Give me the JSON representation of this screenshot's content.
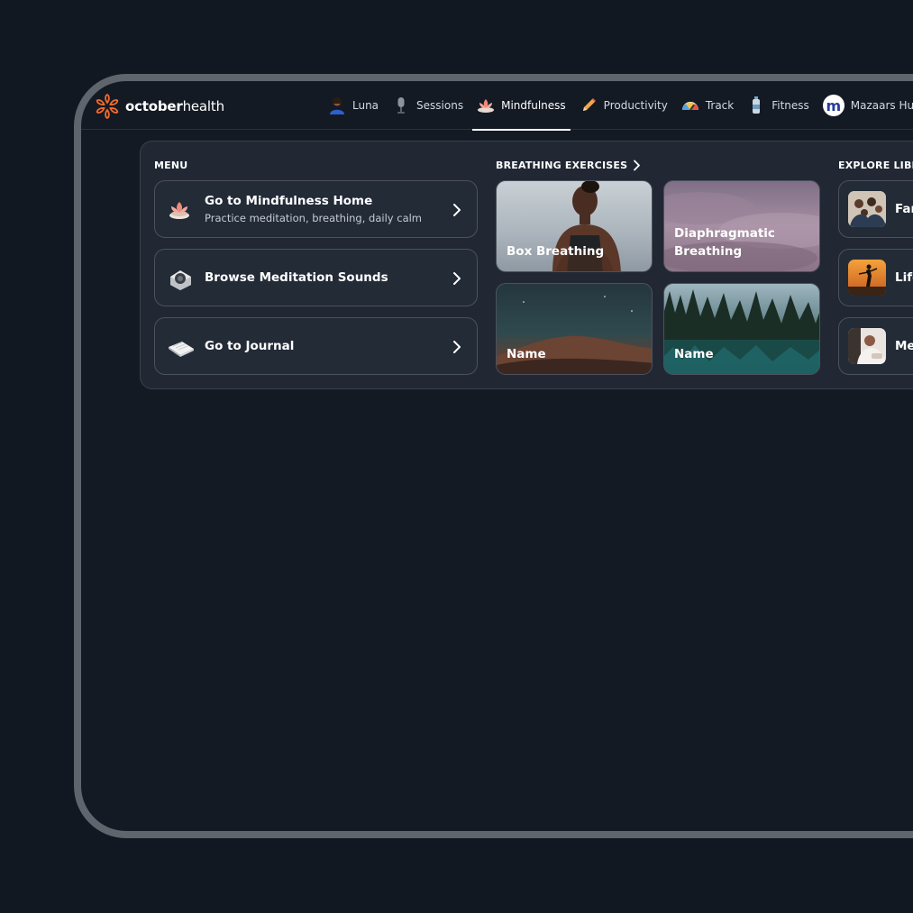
{
  "brand": {
    "name_bold": "october",
    "name_light": "health"
  },
  "nav": {
    "items": [
      {
        "label": "Luna",
        "icon": "luna-avatar-icon"
      },
      {
        "label": "Sessions",
        "icon": "microphone-icon"
      },
      {
        "label": "Mindfulness",
        "icon": "lotus-icon",
        "active": true
      },
      {
        "label": "Productivity",
        "icon": "pencil-icon"
      },
      {
        "label": "Track",
        "icon": "gauge-icon"
      },
      {
        "label": "Fitness",
        "icon": "water-bottle-icon"
      },
      {
        "label": "Mazaars Hub",
        "icon": "mazaars-logo-icon",
        "avatar_letter": "m"
      }
    ]
  },
  "menu": {
    "title": "MENU",
    "items": [
      {
        "title": "Go to Mindfulness Home",
        "subtitle": "Practice meditation, breathing, daily calm",
        "icon": "lotus-icon"
      },
      {
        "title": "Browse Meditation Sounds",
        "icon": "speaker-icon"
      },
      {
        "title": "Go to Journal",
        "icon": "book-icon"
      }
    ]
  },
  "breathing": {
    "title": "BREATHING EXERCISES",
    "cards": [
      {
        "label": "Box Breathing"
      },
      {
        "label": "Diaphragmatic Breathing"
      },
      {
        "label": "Name"
      },
      {
        "label": "Name"
      }
    ]
  },
  "library": {
    "title": "EXPLORE LIBRARY",
    "items": [
      {
        "label": "Family"
      },
      {
        "label": "Lifestyle"
      },
      {
        "label": "Meditation"
      }
    ]
  },
  "colors": {
    "accent": "#f26b2a",
    "background": "#121821",
    "panel": "#212834",
    "card_border": "#4b525d"
  }
}
